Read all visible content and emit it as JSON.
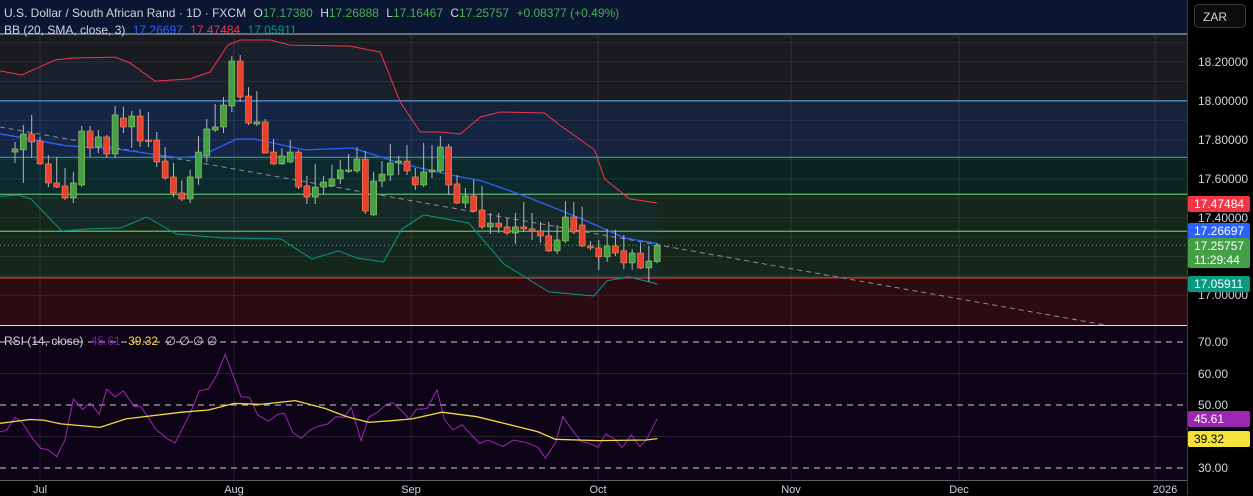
{
  "header": {
    "symbol": "U.S. Dollar / South African Rand · 1D · FXCM",
    "o_label": "O",
    "o_value": "17.17380",
    "h_label": "H",
    "h_value": "17.26888",
    "l_label": "L",
    "l_value": "17.16467",
    "c_label": "C",
    "c_value": "17.25757",
    "change": "+0.08377 (+0.49%)"
  },
  "bb_legend": {
    "label": "BB (20, SMA, close, 3)",
    "basis": "17.26697",
    "upper": "17.47484",
    "lower": "17.05911"
  },
  "rsi_legend": {
    "label": "RSI (14, close)",
    "rsi": "45.61",
    "ma": "39.32",
    "extras": "∅ ∅ ∅ ∅"
  },
  "currency_button": "ZAR",
  "price_axis": [
    "18.20000",
    "18.00000",
    "17.80000",
    "17.60000",
    "17.40000",
    "17.00000"
  ],
  "price_axis_values": [
    18.2,
    18.0,
    17.8,
    17.6,
    17.4,
    17.0
  ],
  "rsi_axis": [
    "70.00",
    "60.00",
    "50.00",
    "30.00"
  ],
  "rsi_axis_values": [
    70,
    60,
    50,
    30
  ],
  "tags": {
    "upper": "17.47484",
    "basis": "17.26697",
    "last": "17.25757",
    "countdown": "11:29:44",
    "lower": "17.05911"
  },
  "time_axis": [
    "Jul",
    "Aug",
    "Sep",
    "Oct",
    "Nov",
    "Dec",
    "2026"
  ],
  "colors": {
    "up": "#43a047",
    "down": "#e8412c",
    "upper": "#f23645",
    "basis": "#2962ff",
    "lower": "#089981",
    "rsi": "#9c27b0",
    "rsi_ma": "#f5d742"
  },
  "chart_data": {
    "type": "candlestick",
    "title": "U.S. Dollar / South African Rand · 1D · FXCM",
    "ylabel": "ZAR",
    "ylim": [
      16.85,
      18.35
    ],
    "x_ticks": [
      "Jul",
      "Aug",
      "Sep",
      "Oct",
      "Nov",
      "Dec",
      "2026"
    ],
    "candles_ohlc": [
      [
        17.737,
        17.789,
        17.681,
        17.753
      ],
      [
        17.748,
        17.876,
        17.578,
        17.83
      ],
      [
        17.83,
        17.928,
        17.707,
        17.789
      ],
      [
        17.794,
        17.815,
        17.671,
        17.676
      ],
      [
        17.676,
        17.722,
        17.557,
        17.578
      ],
      [
        17.578,
        17.712,
        17.552,
        17.557
      ],
      [
        17.563,
        17.655,
        17.491,
        17.501
      ],
      [
        17.501,
        17.635,
        17.475,
        17.578
      ],
      [
        17.568,
        17.871,
        17.557,
        17.845
      ],
      [
        17.845,
        17.871,
        17.712,
        17.758
      ],
      [
        17.763,
        17.85,
        17.732,
        17.815
      ],
      [
        17.815,
        17.825,
        17.707,
        17.727
      ],
      [
        17.727,
        17.974,
        17.707,
        17.928
      ],
      [
        17.912,
        17.969,
        17.835,
        17.866
      ],
      [
        17.866,
        17.948,
        17.758,
        17.922
      ],
      [
        17.922,
        17.958,
        17.763,
        17.794
      ],
      [
        17.799,
        17.943,
        17.763,
        17.795
      ],
      [
        17.799,
        17.84,
        17.66,
        17.686
      ],
      [
        17.691,
        17.763,
        17.594,
        17.604
      ],
      [
        17.609,
        17.681,
        17.506,
        17.527
      ],
      [
        17.527,
        17.594,
        17.485,
        17.496
      ],
      [
        17.496,
        17.645,
        17.475,
        17.609
      ],
      [
        17.604,
        17.82,
        17.568,
        17.737
      ],
      [
        17.717,
        17.907,
        17.686,
        17.856
      ],
      [
        17.85,
        17.984,
        17.84,
        17.866
      ],
      [
        17.866,
        18.02,
        17.835,
        17.979
      ],
      [
        17.974,
        18.231,
        17.943,
        18.205
      ],
      [
        18.205,
        18.236,
        17.994,
        18.02
      ],
      [
        18.025,
        18.071,
        17.876,
        17.886
      ],
      [
        17.881,
        18.051,
        17.871,
        17.892
      ],
      [
        17.892,
        17.907,
        17.732,
        17.732
      ],
      [
        17.737,
        17.804,
        17.671,
        17.676
      ],
      [
        17.676,
        17.758,
        17.671,
        17.717
      ],
      [
        17.686,
        17.799,
        17.681,
        17.737
      ],
      [
        17.737,
        17.748,
        17.547,
        17.557
      ],
      [
        17.563,
        17.614,
        17.47,
        17.506
      ],
      [
        17.506,
        17.676,
        17.47,
        17.557
      ],
      [
        17.557,
        17.614,
        17.521,
        17.583
      ],
      [
        17.563,
        17.671,
        17.557,
        17.599
      ],
      [
        17.599,
        17.696,
        17.573,
        17.645
      ],
      [
        17.642,
        17.727,
        17.63,
        17.645
      ],
      [
        17.64,
        17.763,
        17.63,
        17.701
      ],
      [
        17.701,
        17.743,
        17.419,
        17.434
      ],
      [
        17.414,
        17.635,
        17.409,
        17.588
      ],
      [
        17.588,
        17.691,
        17.557,
        17.624
      ],
      [
        17.619,
        17.778,
        17.588,
        17.681
      ],
      [
        17.681,
        17.717,
        17.619,
        17.691
      ],
      [
        17.691,
        17.773,
        17.619,
        17.64
      ],
      [
        17.609,
        17.655,
        17.542,
        17.568
      ],
      [
        17.568,
        17.784,
        17.557,
        17.635
      ],
      [
        17.635,
        17.773,
        17.604,
        17.645
      ],
      [
        17.64,
        17.82,
        17.63,
        17.763
      ],
      [
        17.763,
        17.778,
        17.516,
        17.568
      ],
      [
        17.573,
        17.619,
        17.47,
        17.475
      ],
      [
        17.475,
        17.552,
        17.449,
        17.511
      ],
      [
        17.511,
        17.594,
        17.429,
        17.434
      ],
      [
        17.439,
        17.563,
        17.342,
        17.352
      ],
      [
        17.352,
        17.424,
        17.316,
        17.372
      ],
      [
        17.372,
        17.424,
        17.321,
        17.352
      ],
      [
        17.352,
        17.398,
        17.311,
        17.321
      ],
      [
        17.321,
        17.424,
        17.265,
        17.352
      ],
      [
        17.352,
        17.48,
        17.326,
        17.342
      ],
      [
        17.342,
        17.424,
        17.285,
        17.331
      ],
      [
        17.331,
        17.378,
        17.27,
        17.306
      ],
      [
        17.306,
        17.378,
        17.223,
        17.229
      ],
      [
        17.229,
        17.362,
        17.213,
        17.285
      ],
      [
        17.28,
        17.485,
        17.27,
        17.403
      ],
      [
        17.403,
        17.48,
        17.316,
        17.326
      ],
      [
        17.362,
        17.455,
        17.249,
        17.254
      ],
      [
        17.254,
        17.28,
        17.234,
        17.244
      ],
      [
        17.244,
        17.285,
        17.131,
        17.198
      ],
      [
        17.198,
        17.342,
        17.172,
        17.254
      ],
      [
        17.254,
        17.337,
        17.203,
        17.218
      ],
      [
        17.229,
        17.311,
        17.136,
        17.167
      ],
      [
        17.167,
        17.239,
        17.131,
        17.218
      ],
      [
        17.218,
        17.27,
        17.136,
        17.141
      ],
      [
        17.141,
        17.254,
        17.069,
        17.177
      ],
      [
        17.1738,
        17.26888,
        17.16467,
        17.25757
      ]
    ],
    "bb_upper": [
      [
        -0.8,
        18.154
      ],
      [
        1.8,
        18.133
      ],
      [
        5.8,
        18.21
      ],
      [
        7.6,
        18.22
      ],
      [
        13,
        18.225
      ],
      [
        14.8,
        18.195
      ],
      [
        17.8,
        18.102
      ],
      [
        22,
        18.113
      ],
      [
        24.4,
        18.149
      ],
      [
        26.5,
        18.287
      ],
      [
        28,
        18.313
      ],
      [
        31.6,
        18.313
      ],
      [
        34,
        18.287
      ],
      [
        41.2,
        18.282
      ],
      [
        44.8,
        18.251
      ],
      [
        47.2,
        17.994
      ],
      [
        49.6,
        17.84
      ],
      [
        52,
        17.84
      ],
      [
        54.4,
        17.83
      ],
      [
        56.8,
        17.917
      ],
      [
        59.2,
        17.943
      ],
      [
        64.5,
        17.938
      ],
      [
        66.3,
        17.876
      ],
      [
        70.5,
        17.748
      ],
      [
        71.7,
        17.599
      ],
      [
        74.7,
        17.496
      ],
      [
        78,
        17.47484
      ]
    ],
    "bb_basis": [
      [
        -0.8,
        17.831
      ],
      [
        7.2,
        17.769
      ],
      [
        13.1,
        17.753
      ],
      [
        20.7,
        17.707
      ],
      [
        23.3,
        17.717
      ],
      [
        27.6,
        17.804
      ],
      [
        29.7,
        17.804
      ],
      [
        35.7,
        17.748
      ],
      [
        41.5,
        17.758
      ],
      [
        47.4,
        17.676
      ],
      [
        52.7,
        17.624
      ],
      [
        57,
        17.588
      ],
      [
        62.4,
        17.506
      ],
      [
        68.7,
        17.398
      ],
      [
        74.1,
        17.295
      ],
      [
        78,
        17.26697
      ]
    ],
    "bb_lower": [
      [
        -0.8,
        17.509
      ],
      [
        1.4,
        17.516
      ],
      [
        2.9,
        17.496
      ],
      [
        6.6,
        17.331
      ],
      [
        9.9,
        17.342
      ],
      [
        13.7,
        17.347
      ],
      [
        16.8,
        17.403
      ],
      [
        20.3,
        17.316
      ],
      [
        25.9,
        17.295
      ],
      [
        32.9,
        17.29
      ],
      [
        36.6,
        17.187
      ],
      [
        39.8,
        17.229
      ],
      [
        42,
        17.192
      ],
      [
        45.2,
        17.172
      ],
      [
        47.4,
        17.342
      ],
      [
        50,
        17.414
      ],
      [
        55.4,
        17.372
      ],
      [
        59.6,
        17.162
      ],
      [
        65,
        17.018
      ],
      [
        70.4,
        16.997
      ],
      [
        72,
        17.075
      ],
      [
        74.6,
        17.095
      ],
      [
        78,
        17.05911
      ]
    ],
    "trendline": [
      [
        -0.8,
        17.866
      ],
      [
        131.7,
        16.848
      ]
    ],
    "zones": [
      18.0,
      17.71,
      17.52,
      17.33,
      17.09
    ],
    "last_price": 17.25757,
    "rsi": {
      "ylim": [
        25,
        80
      ],
      "levels": [
        70,
        50,
        30
      ],
      "values": [
        [
          -0.8,
          41.5
        ],
        [
          0,
          42
        ],
        [
          1,
          46.1
        ],
        [
          1.8,
          44.7
        ],
        [
          3.1,
          39.4
        ],
        [
          4.1,
          36.2
        ],
        [
          4.9,
          35.9
        ],
        [
          6,
          33.6
        ],
        [
          7,
          38.9
        ],
        [
          8,
          51.9
        ],
        [
          9.1,
          48.6
        ],
        [
          10,
          50.7
        ],
        [
          11.1,
          47.1
        ],
        [
          12,
          55
        ],
        [
          13,
          52.6
        ],
        [
          14,
          54.5
        ],
        [
          15.3,
          49.5
        ],
        [
          16.1,
          49.5
        ],
        [
          17.9,
          42.3
        ],
        [
          19.2,
          39.4
        ],
        [
          20.2,
          38
        ],
        [
          22.1,
          47.9
        ],
        [
          23.1,
          54.5
        ],
        [
          24.2,
          55.1
        ],
        [
          25.2,
          59.5
        ],
        [
          26.2,
          66.1
        ],
        [
          27.5,
          56.9
        ],
        [
          28.1,
          52.6
        ],
        [
          29.1,
          52.4
        ],
        [
          30.1,
          46.8
        ],
        [
          31.4,
          44.9
        ],
        [
          32.5,
          47
        ],
        [
          33.3,
          47.4
        ],
        [
          34.3,
          41.3
        ],
        [
          35.3,
          39.4
        ],
        [
          36.4,
          42.1
        ],
        [
          37.4,
          43.3
        ],
        [
          38.5,
          44
        ],
        [
          39.5,
          46.3
        ],
        [
          40.5,
          46.1
        ],
        [
          41.3,
          49.3
        ],
        [
          42.5,
          38.6
        ],
        [
          43.4,
          46.1
        ],
        [
          44.4,
          47.6
        ],
        [
          45.5,
          50.2
        ],
        [
          46.3,
          50.7
        ],
        [
          47.3,
          48.4
        ],
        [
          48.3,
          45.4
        ],
        [
          49.1,
          48.6
        ],
        [
          50.4,
          48.9
        ],
        [
          51.6,
          54.8
        ],
        [
          52.5,
          45.4
        ],
        [
          53.5,
          42.1
        ],
        [
          54.6,
          43.7
        ],
        [
          56.7,
          37.8
        ],
        [
          57.7,
          38.9
        ],
        [
          59.5,
          36.8
        ],
        [
          60.8,
          38.9
        ],
        [
          62.4,
          38
        ],
        [
          63.7,
          36.6
        ],
        [
          64.6,
          33.1
        ],
        [
          65.8,
          38
        ],
        [
          66.7,
          46.3
        ],
        [
          67.8,
          42.1
        ],
        [
          68.9,
          38.4
        ],
        [
          69.9,
          37.8
        ],
        [
          70.9,
          36.5
        ],
        [
          71.8,
          40.8
        ],
        [
          72.9,
          39.2
        ],
        [
          73.8,
          36.5
        ],
        [
          74.9,
          40.5
        ],
        [
          75.9,
          36.8
        ],
        [
          76.7,
          38.9
        ],
        [
          78,
          45.61
        ]
      ],
      "ma": [
        [
          -0.8,
          44.2
        ],
        [
          2.8,
          45.4
        ],
        [
          4.4,
          45.2
        ],
        [
          6.5,
          44
        ],
        [
          11.2,
          42.9
        ],
        [
          14.3,
          45.6
        ],
        [
          21,
          47.7
        ],
        [
          24.2,
          48.4
        ],
        [
          27.3,
          50.5
        ],
        [
          30.4,
          50.2
        ],
        [
          34.6,
          51.4
        ],
        [
          38.2,
          48.9
        ],
        [
          40.8,
          46.3
        ],
        [
          43.4,
          44.5
        ],
        [
          46,
          45
        ],
        [
          48.6,
          45.6
        ],
        [
          52.2,
          47.7
        ],
        [
          56.4,
          46.3
        ],
        [
          61.6,
          42.9
        ],
        [
          63.7,
          41.5
        ],
        [
          65.8,
          39.1
        ],
        [
          71,
          38.7
        ],
        [
          76.7,
          38.9
        ],
        [
          78,
          39.32
        ]
      ]
    }
  }
}
